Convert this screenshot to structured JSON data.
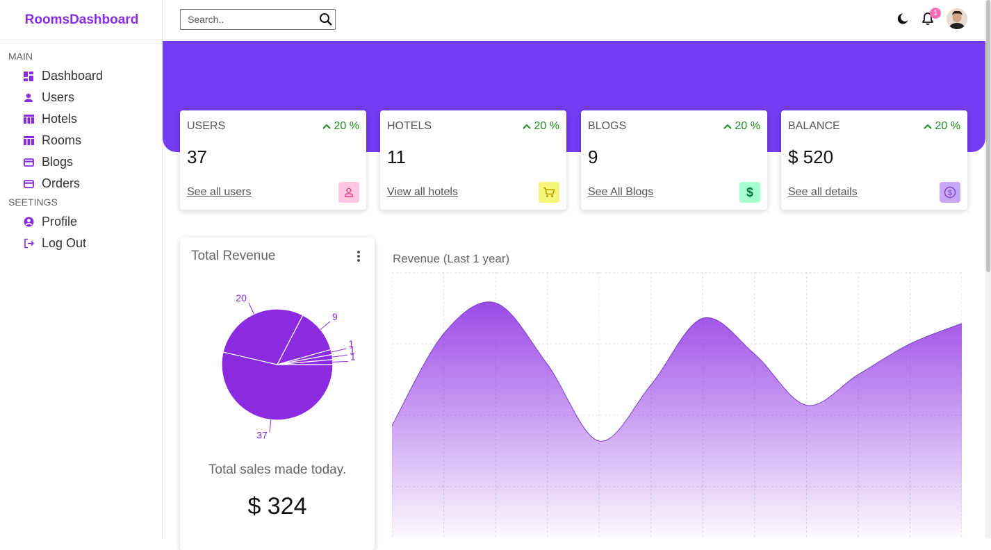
{
  "app": {
    "logo": "RoomsDashboard"
  },
  "sidebar": {
    "sections": [
      {
        "title": "MAIN",
        "items": [
          {
            "label": "Dashboard",
            "icon": "dashboard-icon"
          },
          {
            "label": "Users",
            "icon": "user-icon"
          },
          {
            "label": "Hotels",
            "icon": "table-icon"
          },
          {
            "label": "Rooms",
            "icon": "table-icon"
          },
          {
            "label": "Blogs",
            "icon": "credit-card-icon"
          },
          {
            "label": "Orders",
            "icon": "credit-card-icon"
          }
        ]
      },
      {
        "title": "SEETINGS",
        "items": [
          {
            "label": "Profile",
            "icon": "account-circle-icon"
          },
          {
            "label": "Log Out",
            "icon": "logout-icon"
          }
        ]
      }
    ]
  },
  "topbar": {
    "search_placeholder": "Search..",
    "notification_count": "1"
  },
  "colors": {
    "accent": "#8a2be2",
    "banner": "#743cf3",
    "positive": "#1d8a1d"
  },
  "widgets": [
    {
      "title": "USERS",
      "percent": "20 %",
      "value": "37",
      "link": "See all users",
      "icon": "person-outline-icon",
      "icon_bg": "#ffc8e0",
      "icon_color": "#e23d8b"
    },
    {
      "title": "HOTELS",
      "percent": "20 %",
      "value": "11",
      "link": "View all hotels",
      "icon": "shopping-cart-icon",
      "icon_bg": "#f5f579",
      "icon_color": "#b59b00"
    },
    {
      "title": "BLOGS",
      "percent": "20 %",
      "value": "9",
      "link": "See All Blogs",
      "icon": "dollar-icon",
      "icon_bg": "#a6ffd0",
      "icon_color": "#0c7a3c"
    },
    {
      "title": "BALANCE",
      "percent": "20 %",
      "value": "$ 520",
      "link": "See all details",
      "icon": "monetization-icon",
      "icon_bg": "#c8a8f5",
      "icon_color": "#7a3ec8"
    }
  ],
  "revenue": {
    "title": "Total Revenue",
    "description": "Total sales made today.",
    "amount": "$ 324"
  },
  "charts": {
    "area_title": "Revenue (Last 1 year)"
  },
  "chart_data": [
    {
      "type": "pie",
      "title": "",
      "values": [
        37,
        20,
        9,
        1,
        1,
        1
      ],
      "labels": [
        "37",
        "20",
        "9",
        "1",
        "1",
        "1"
      ],
      "color": "#8a2be2"
    },
    {
      "type": "area",
      "title": "Revenue (Last 1 year)",
      "values": [
        800,
        1700,
        2000,
        1400,
        650,
        1200,
        1850,
        1500,
        1000,
        1300,
        1600,
        1800
      ],
      "ylim": [
        -300,
        2300
      ],
      "grid": true,
      "color": "#8a2be2"
    }
  ]
}
